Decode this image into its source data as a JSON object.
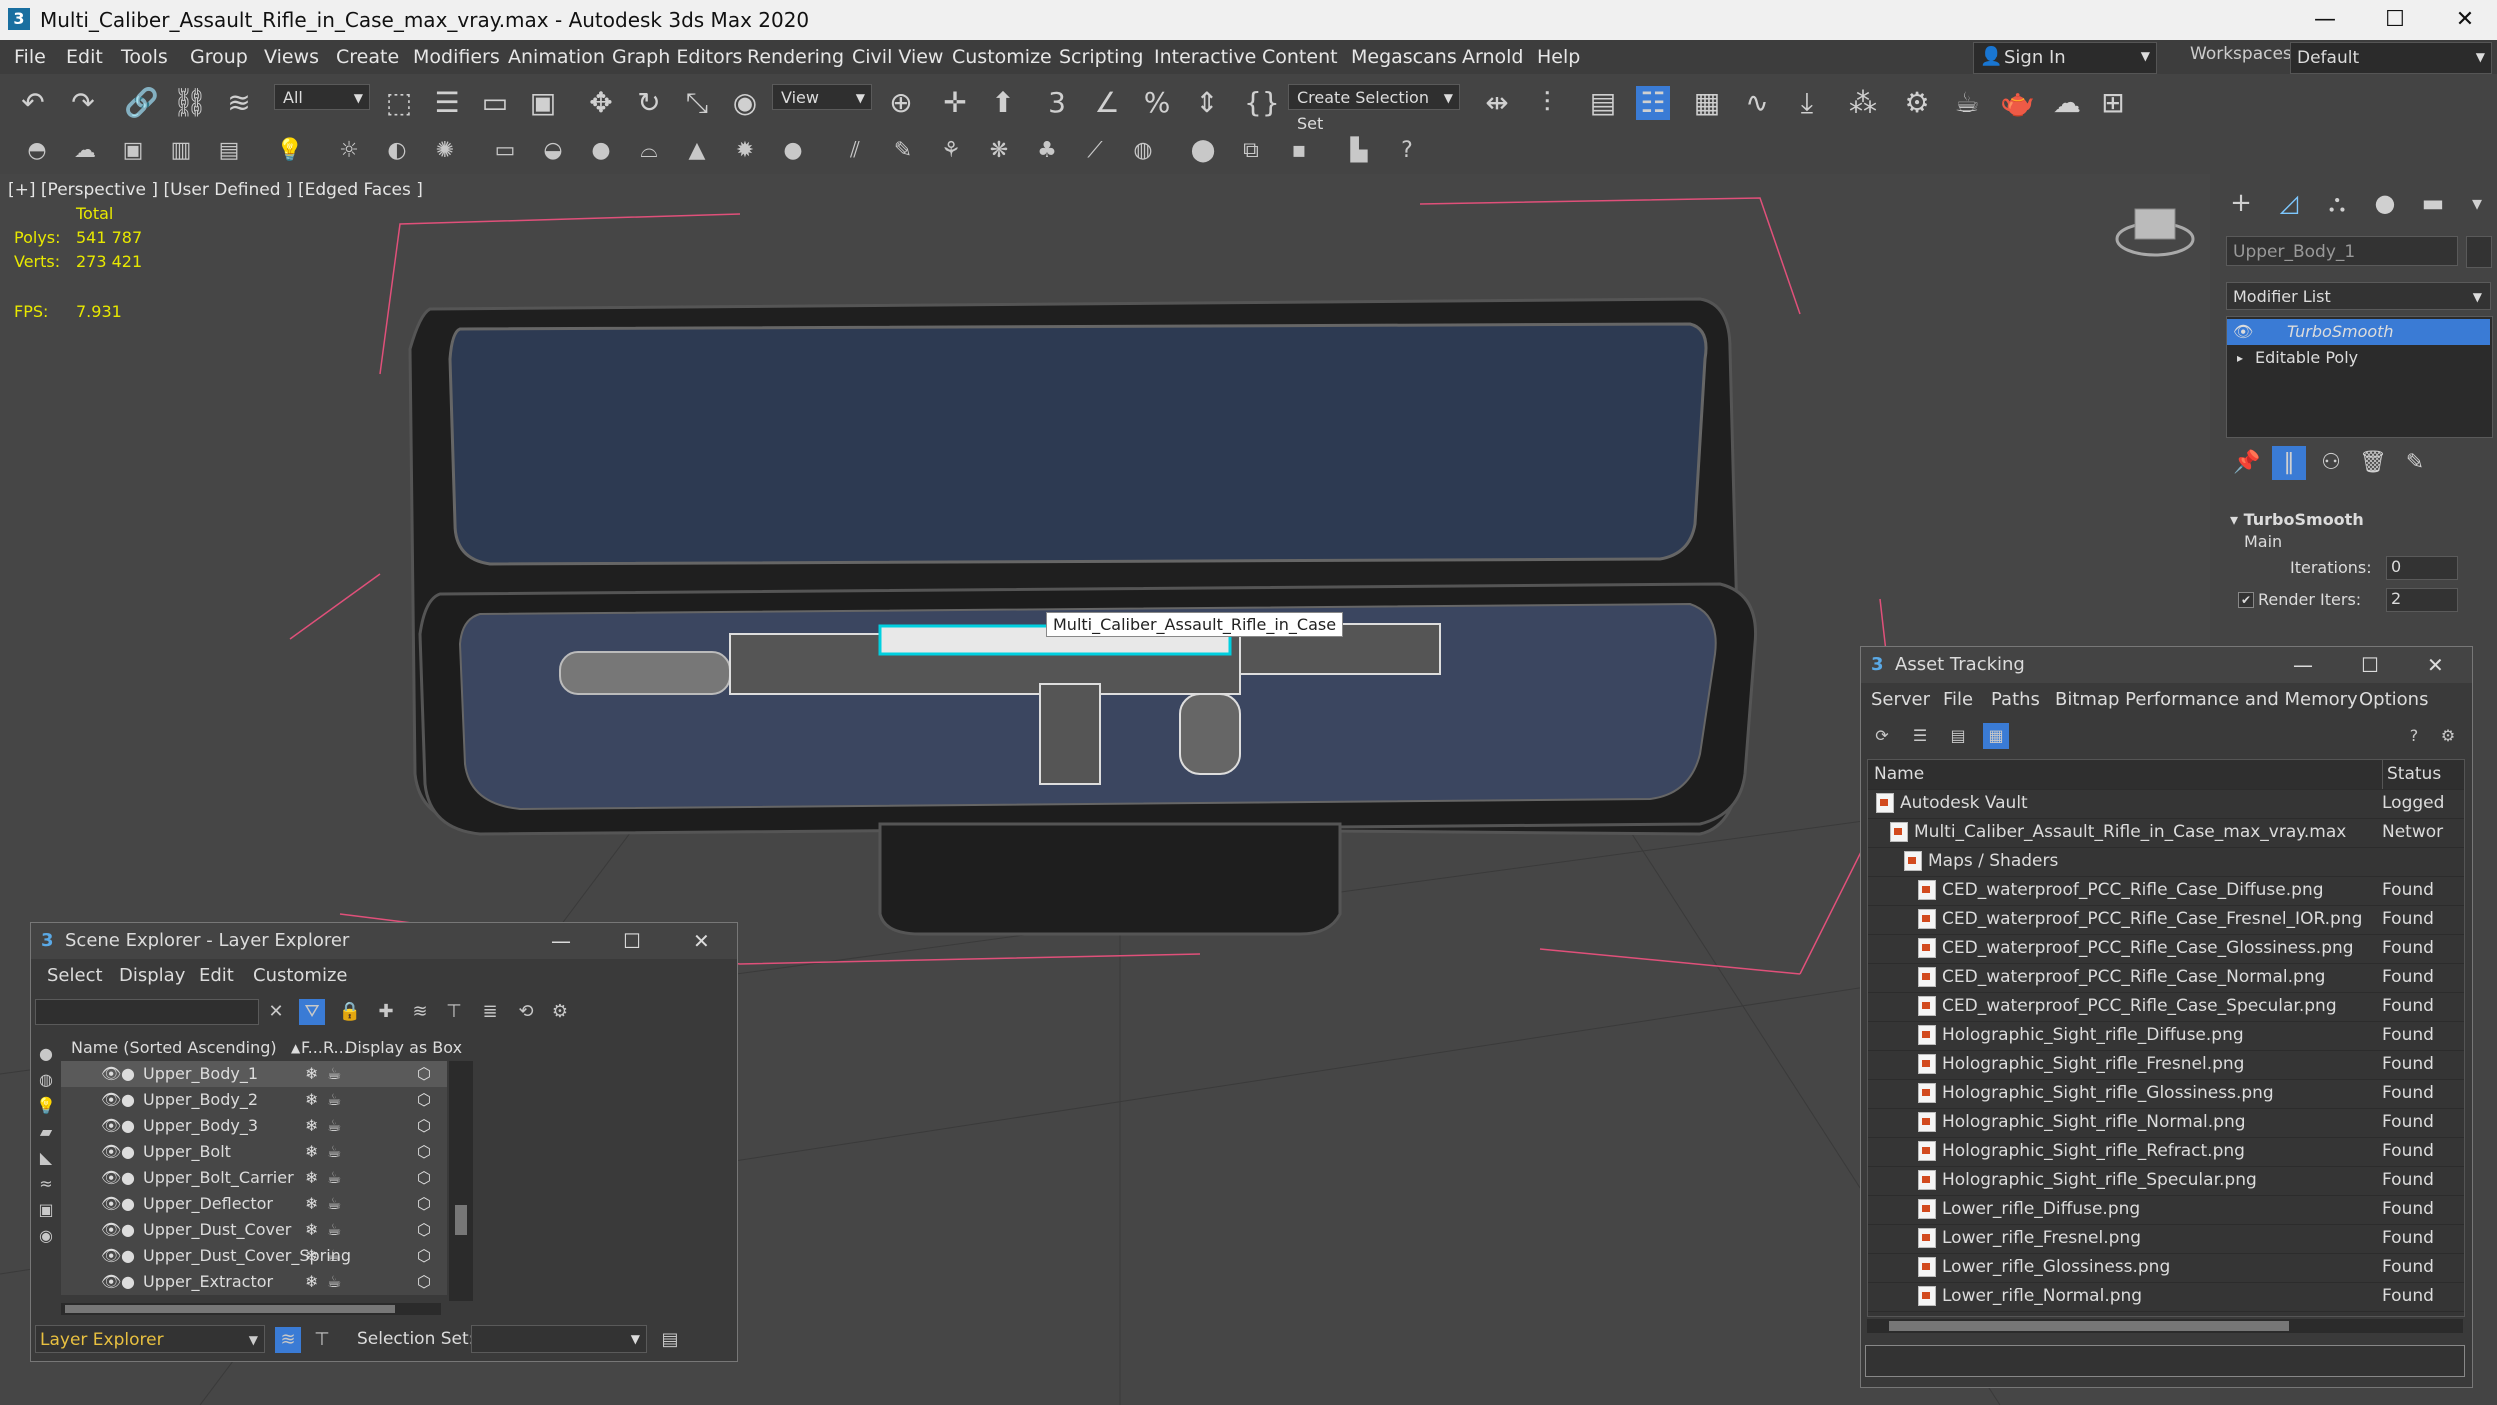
{
  "window": {
    "title": "Multi_Caliber_Assault_Rifle_in_Case_max_vray.max - Autodesk 3ds Max 2020",
    "app_icon": "3",
    "minimize": "—",
    "maximize": "☐",
    "close": "✕"
  },
  "menubar": {
    "items": [
      "File",
      "Edit",
      "Tools",
      "Group",
      "Views",
      "Create",
      "Modifiers",
      "Animation",
      "Graph Editors",
      "Rendering",
      "Civil View",
      "Customize",
      "Scripting",
      "Interactive",
      "Content",
      "Megascans",
      "Arnold",
      "Help"
    ],
    "sign_in": "Sign In",
    "workspaces_label": "Workspaces:",
    "workspace_value": "Default"
  },
  "toolbar": {
    "filter_select": "All",
    "view_select": "View",
    "selection_set": "Create Selection Set"
  },
  "viewport": {
    "label": "[+] [Perspective ] [User Defined ] [Edged Faces ]",
    "stats_total": "Total",
    "polys_label": "Polys:",
    "polys_value": "541 787",
    "verts_label": "Verts:",
    "verts_value": "273 421",
    "fps_label": "FPS:",
    "fps_value": "7.931",
    "object_label": "Multi_Caliber_Assault_Rifle_in_Case"
  },
  "command_panel": {
    "object_name": "Upper_Body_1",
    "modifier_list": "Modifier List",
    "stack": [
      "TurboSmooth",
      "Editable Poly"
    ],
    "rollout_title": "TurboSmooth",
    "main_label": "Main",
    "iterations_label": "Iterations:",
    "iterations_value": "0",
    "render_iters_label": "Render Iters:",
    "render_iters_value": "2"
  },
  "asset_tracking": {
    "title": "Asset Tracking",
    "menu": [
      "Server",
      "File",
      "Paths",
      "Bitmap Performance and Memory",
      "Options"
    ],
    "col_name": "Name",
    "col_status": "Status",
    "rows": [
      {
        "name": "Autodesk Vault",
        "status": "Logged",
        "indent": 0,
        "kind": "vault"
      },
      {
        "name": "Multi_Caliber_Assault_Rifle_in_Case_max_vray.max",
        "status": "Networ",
        "indent": 1,
        "kind": "max"
      },
      {
        "name": "Maps / Shaders",
        "status": "",
        "indent": 2,
        "kind": "folder"
      },
      {
        "name": "CED_waterproof_PCC_Rifle_Case_Diffuse.png",
        "status": "Found",
        "indent": 3,
        "kind": "file"
      },
      {
        "name": "CED_waterproof_PCC_Rifle_Case_Fresnel_IOR.png",
        "status": "Found",
        "indent": 3,
        "kind": "file"
      },
      {
        "name": "CED_waterproof_PCC_Rifle_Case_Glossiness.png",
        "status": "Found",
        "indent": 3,
        "kind": "file"
      },
      {
        "name": "CED_waterproof_PCC_Rifle_Case_Normal.png",
        "status": "Found",
        "indent": 3,
        "kind": "file"
      },
      {
        "name": "CED_waterproof_PCC_Rifle_Case_Specular.png",
        "status": "Found",
        "indent": 3,
        "kind": "file"
      },
      {
        "name": "Holographic_Sight_rifle_Diffuse.png",
        "status": "Found",
        "indent": 3,
        "kind": "file"
      },
      {
        "name": "Holographic_Sight_rifle_Fresnel.png",
        "status": "Found",
        "indent": 3,
        "kind": "file"
      },
      {
        "name": "Holographic_Sight_rifle_Glossiness.png",
        "status": "Found",
        "indent": 3,
        "kind": "file"
      },
      {
        "name": "Holographic_Sight_rifle_Normal.png",
        "status": "Found",
        "indent": 3,
        "kind": "file"
      },
      {
        "name": "Holographic_Sight_rifle_Refract.png",
        "status": "Found",
        "indent": 3,
        "kind": "file"
      },
      {
        "name": "Holographic_Sight_rifle_Specular.png",
        "status": "Found",
        "indent": 3,
        "kind": "file"
      },
      {
        "name": "Lower_rifle_Diffuse.png",
        "status": "Found",
        "indent": 3,
        "kind": "file"
      },
      {
        "name": "Lower_rifle_Fresnel.png",
        "status": "Found",
        "indent": 3,
        "kind": "file"
      },
      {
        "name": "Lower_rifle_Glossiness.png",
        "status": "Found",
        "indent": 3,
        "kind": "file"
      },
      {
        "name": "Lower_rifle_Normal.png",
        "status": "Found",
        "indent": 3,
        "kind": "file"
      }
    ]
  },
  "scene_explorer": {
    "title": "Scene Explorer - Layer Explorer",
    "menu": [
      "Select",
      "Display",
      "Edit",
      "Customize"
    ],
    "col_name": "Name (Sorted Ascending)",
    "col_f": "F...",
    "col_r": "R...",
    "col_display_box": "Display as Box",
    "rows": [
      "Upper_Body_1",
      "Upper_Body_2",
      "Upper_Body_3",
      "Upper_Bolt",
      "Upper_Bolt_Carrier",
      "Upper_Deflector",
      "Upper_Dust_Cover",
      "Upper_Dust_Cover_Spring",
      "Upper_Extractor"
    ],
    "bottom_layer": "Layer Explorer",
    "selection_set_label": "Selection Set:"
  },
  "colors": {
    "accent": "#3a7bd5",
    "stat_text": "#e8e800",
    "selection_wire": "#00d0e0",
    "bbox_lines": "#e0507a"
  }
}
